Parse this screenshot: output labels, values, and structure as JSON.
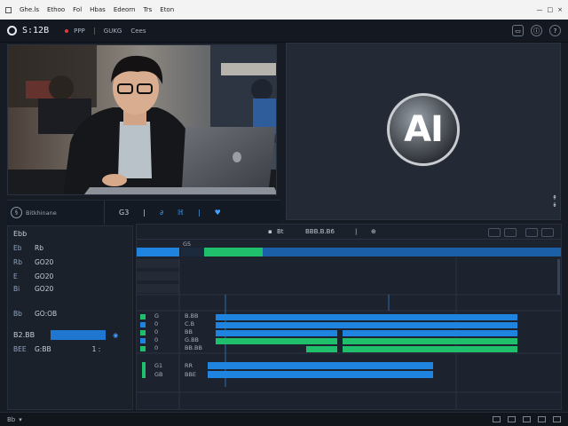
{
  "os_menu": {
    "items": [
      "Ghe.ls",
      "Ethoo",
      "Fol",
      "Hbas",
      "Edeorn",
      "Trs",
      "Eton"
    ],
    "right_items": [
      "—",
      "□",
      "×"
    ]
  },
  "app": {
    "title": "S:12B",
    "header_items": [
      "PPP",
      "GUKG",
      "Cees"
    ]
  },
  "ai_panel": {
    "badge_text": "AI",
    "scroll_glyphs": [
      "↟",
      "↡"
    ]
  },
  "camera_controls": {
    "label": "Bitkhinane",
    "buttons": [
      "G3",
      "|",
      "∂",
      "ℍ",
      "|",
      "♥"
    ]
  },
  "left_panel": {
    "header": "Ebb",
    "rows": [
      {
        "k": "Eb",
        "v": "Rb"
      },
      {
        "k": "Rb",
        "v": "GO20"
      },
      {
        "k": "E",
        "v": "GO20"
      },
      {
        "k": "Bi",
        "v": "GO20"
      },
      {
        "k": "Bb",
        "v": "GO:OB"
      }
    ],
    "selected_label": "B2.BB",
    "bottom_row": {
      "k": "BEE",
      "v": "G:BB",
      "extra": "1  :"
    }
  },
  "timeline": {
    "toolbar": {
      "center_label": "Bt",
      "title": "BBB.B.B6",
      "right_glyph": "⊕"
    },
    "ruler_label": "G5",
    "tracks": [
      {
        "num": "G",
        "name": "B.BB"
      },
      {
        "num": "0",
        "name": "C.B"
      },
      {
        "num": "0",
        "name": "BB"
      },
      {
        "num": "0",
        "name": "G.BB"
      },
      {
        "num": "0",
        "name": "BB.BB"
      }
    ],
    "sub_tracks": [
      {
        "num": "G1",
        "name": "RR"
      },
      {
        "num": "GB",
        "name": "BBE"
      }
    ]
  },
  "status_bar": {
    "left": "Bb"
  },
  "colors": {
    "accent_blue": "#1f84e0",
    "accent_green": "#1fbf6b",
    "panel_bg": "#1d232e"
  }
}
